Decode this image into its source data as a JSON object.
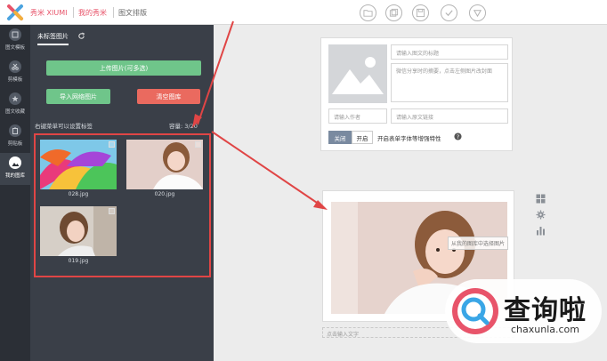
{
  "header": {
    "app_name": "秀米 XIUMI",
    "nav": [
      "我的秀米",
      "图文排版"
    ]
  },
  "toolbar": {
    "icons": [
      "folder-icon",
      "copy-icon",
      "save-icon",
      "check-icon",
      "chevron-down-icon"
    ]
  },
  "rail": {
    "items": [
      {
        "label": "图文模板",
        "icon": "template-icon"
      },
      {
        "label": "剪模板",
        "icon": "scissors-icon"
      },
      {
        "label": "图文收藏",
        "icon": "star-icon"
      },
      {
        "label": "剪贴板",
        "icon": "clipboard-icon"
      },
      {
        "label": "我的图库",
        "icon": "gallery-icon",
        "active": true
      }
    ]
  },
  "panel": {
    "tab_label": "未标签图片",
    "upload_label": "上传图片(可多选)",
    "import_label": "导入网络图片",
    "clear_label": "清空图库",
    "tip": "右键菜单可以设置标签",
    "capacity": "容量: 3/20",
    "thumbnails": [
      {
        "caption": "028.jpg",
        "kind": "umbrellas"
      },
      {
        "caption": "020.jpg",
        "kind": "girl-pink"
      },
      {
        "caption": "019.jpg",
        "kind": "girl-hand"
      }
    ]
  },
  "editor": {
    "title_placeholder": "请输入图文的标题",
    "summary_placeholder": "微信分享时的摘要，点击左侧图片改封面",
    "author_placeholder": "请输入作者",
    "link_placeholder": "请输入原文链接",
    "toggle_off": "关闭",
    "toggle_on": "开启",
    "toggle_label": "开启表单字体等增强特性",
    "photo_tip": "从我的图库中选择图片",
    "text_placeholder": "点击输入文字"
  },
  "side_tools": [
    "grid-icon",
    "gear-icon",
    "bar-chart-icon"
  ],
  "watermark": {
    "cn": "查询啦",
    "en": "chaxunla.com"
  },
  "colors": {
    "accent_green": "#6fc58a",
    "accent_red": "#ea6a5f",
    "brand_pink": "#e8546a",
    "arrow_red": "#e04545"
  }
}
